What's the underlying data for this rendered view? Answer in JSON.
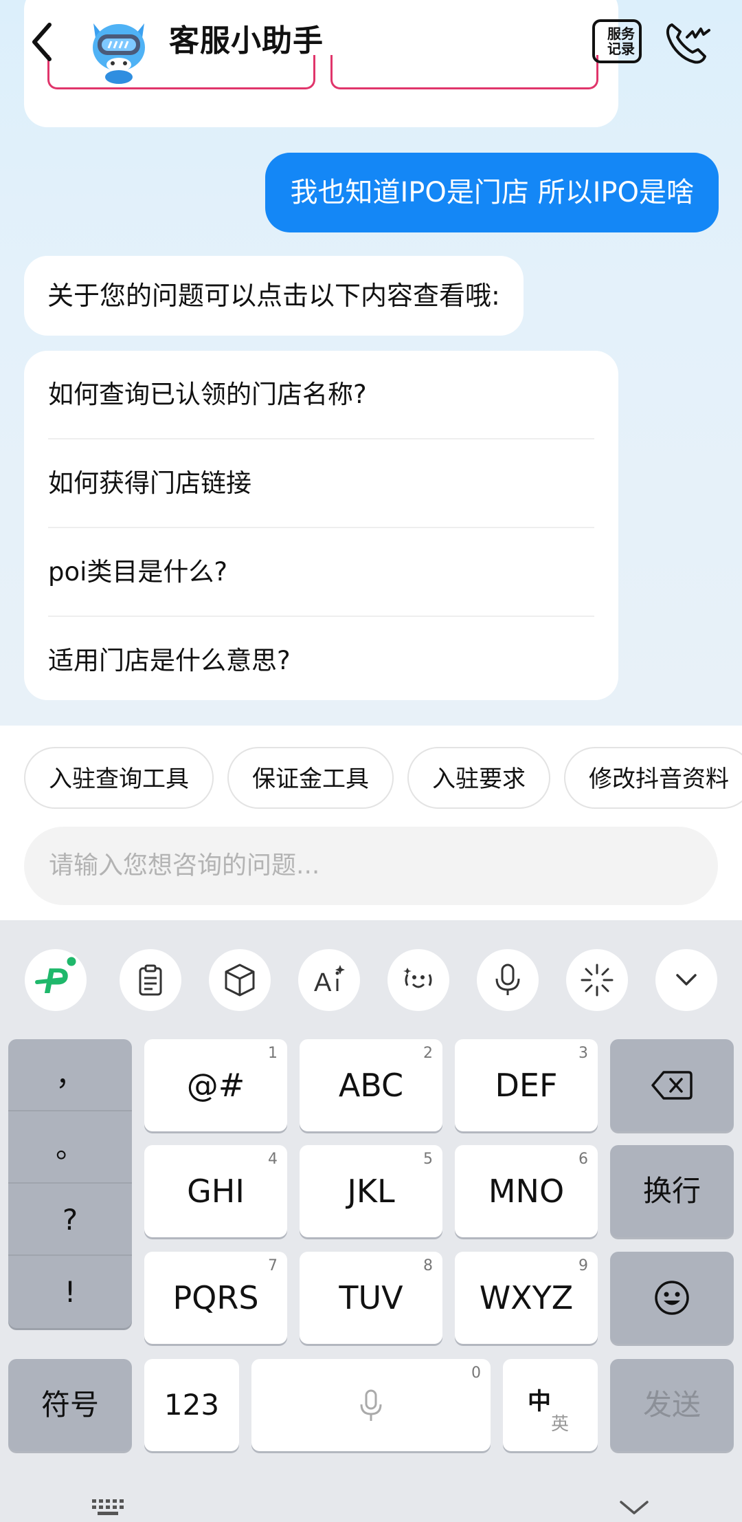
{
  "header": {
    "title": "客服小助手",
    "service_record": "服务记录",
    "service_record_line1": "服务",
    "service_record_line2": "记录"
  },
  "chat": {
    "user_message": "我也知道IPO是门店 所以IPO是啥",
    "bot_message": "关于您的问题可以点击以下内容查看哦:",
    "faq": [
      "如何查询已认领的门店名称?",
      "如何获得门店链接",
      "poi类目是什么?",
      "适用门店是什么意思?"
    ]
  },
  "quick_actions": [
    "入驻查询工具",
    "保证金工具",
    "入驻要求",
    "修改抖音资料"
  ],
  "input": {
    "placeholder": "请输入您想咨询的问题..."
  },
  "keyboard": {
    "toolbar_icons": [
      "ime-logo-icon",
      "clipboard-icon",
      "cube-icon",
      "ai-text-icon",
      "face-icon",
      "microphone-icon",
      "sparkle-icon",
      "chevron-down-icon"
    ],
    "punctuation": [
      "，",
      "。",
      "?",
      "!"
    ],
    "rows": [
      [
        {
          "label": "@#",
          "num": "1"
        },
        {
          "label": "ABC",
          "num": "2"
        },
        {
          "label": "DEF",
          "num": "3"
        }
      ],
      [
        {
          "label": "GHI",
          "num": "4"
        },
        {
          "label": "JKL",
          "num": "5"
        },
        {
          "label": "MNO",
          "num": "6"
        }
      ],
      [
        {
          "label": "PQRS",
          "num": "7"
        },
        {
          "label": "TUV",
          "num": "8"
        },
        {
          "label": "WXYZ",
          "num": "9"
        }
      ]
    ],
    "newline": "换行",
    "symbols": "符号",
    "numbers": "123",
    "space_num": "0",
    "lang_zh": "中",
    "lang_en": "英",
    "send": "发送"
  },
  "colors": {
    "accent": "#1487f6",
    "keyboard_bg": "#e6e8ec",
    "gray_key": "#aeb3bd"
  }
}
